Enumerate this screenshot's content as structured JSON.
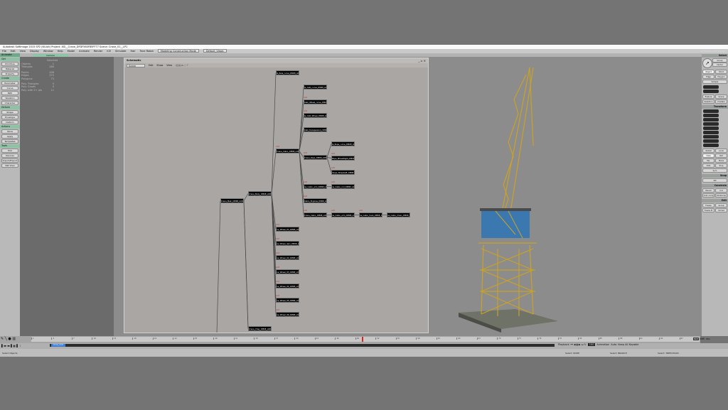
{
  "window": {
    "title": "Autodesk Softimage 2015 SP2 (64-bit)    Project: XSI__Crane_DFDF560F85FF77    Scene: Crane_01__LP1"
  },
  "menu": {
    "items": [
      "File",
      "Edit",
      "View",
      "Display",
      "Window",
      "Help",
      "Model",
      "Animate",
      "Render",
      "ICE",
      "Simulate",
      "Hair",
      "Face Robot"
    ],
    "mode": "Modeling Construction Mode",
    "layout": "Default_Views"
  },
  "toolbar": {
    "module": "Animate",
    "camera": "Camera",
    "brand": "AUTODESK SOFTIMAGE"
  },
  "left_panel": {
    "groups": [
      {
        "header": "Get",
        "items": [
          "Primitive",
          "Material",
          "Property"
        ]
      },
      {
        "header": "Create",
        "items": [
          "Parameter",
          "Curve",
          "Path",
          "Skeleton",
          "Character"
        ]
      },
      {
        "header": "Deform",
        "items": [
          "Shape",
          "Envelope",
          "Deform"
        ]
      },
      {
        "header": "Actions",
        "items": [
          "Store",
          "Apply",
          "Templates"
        ]
      },
      {
        "header": "Tools",
        "items": [
          "Plot",
          "Devices",
          "Import/Export",
          "Net View"
        ]
      }
    ]
  },
  "info": {
    "heading": "Selected",
    "rows": [
      [
        "Objects",
        "1"
      ],
      [
        "Triangles",
        "280"
      ],
      [
        "Points",
        "208"
      ],
      [
        "Edges",
        "272"
      ],
      [
        "Polygons",
        "73"
      ],
      [
        "Poly. Triangles",
        "0"
      ],
      [
        "Poly. Quads",
        "0"
      ],
      [
        "Poly. with 5+ pts",
        "11"
      ]
    ]
  },
  "schematic": {
    "title": "Schematic",
    "scope": "Scene",
    "menus": [
      "Edit",
      "Show",
      "View"
    ],
    "tag": "Add",
    "nodes": [
      "la_Rule_curve_DM08_LO",
      "la_Cabl_curve_DM08_LO",
      "Cabl_Wheel_curve_DM08",
      "la_Cabl_Wheel_DM08_LO",
      "Cabl_transparency_DM08",
      "Crane_Cabin_DM08_LOD0",
      "Crane_Rope_DM08_LOD0",
      "la_Rope_curve_DM08_LO",
      "Rope_WheelRight_DM08",
      "Rope_WheelLeft_DM08",
      "ne_Cabin_arm_DM08_LO",
      "ne_Cabin_rod_DM08_LO",
      "Cabin_Engines_DM08_LO",
      "Crane_Cabin_DM08_LOD0",
      "ne_Cabin_arm_DM08_LO",
      "ne_Cabin_hook_DM08_LO",
      "ne_Cabin_Chain_DM08_LO",
      "Crane_Body_DM08_LOD0",
      "Crane_Main_DM08_LOD0",
      "ne_Wheel_01_DM08_LO",
      "ne_Wheel_dam_DM08_LO",
      "ne_Wheel_02_DM08_LO",
      "ne_Wheel_03_DM08_LO",
      "ne_Wheel_04_DM08_LO",
      "ne_Wheel_05_DM08_LO",
      "ne_Wheel_06_DM08_LO",
      "Crane_Chay_DM08_LOD0"
    ]
  },
  "right_panel": {
    "select": "Select",
    "group": "Group",
    "center": "Center",
    "object": "Object",
    "point": "Point",
    "edge": "Edge",
    "polygon": "Polygon",
    "sample": "Sample",
    "explore": "Explore",
    "scene": "Scene",
    "selection": "Selection",
    "clusters": "Clusters",
    "transform": "Transform",
    "global": "Global",
    "local": "Local",
    "view": "View",
    "ref": "Ref",
    "par": "Par",
    "plane": "Plane",
    "cog": "COG",
    "prop": "Prop",
    "sym": "Sym",
    "snap": "Snap",
    "on": "ON",
    "constrain": "Constrain",
    "parent": "Parent",
    "cut": "Cut",
    "cnst_comp": "Cnst comp",
    "chld_comp": "ChldComp",
    "edit": "Edit",
    "freeze": "Freeze",
    "group2": "Group",
    "freeze_m": "Freeze M",
    "immed": "Immed"
  },
  "timeline": {
    "start": 1,
    "end": 100,
    "current": 50,
    "clip": "Crane_Anim",
    "playback": "Playback",
    "animation": "Animation",
    "auto": "Auto",
    "keyable": "Keep All Keyable",
    "frame": "100",
    "views": [
      "MCP",
      "KP/L",
      "PPG"
    ]
  },
  "status": {
    "left": "Select Objects",
    "node": "Select: NODE",
    "branch": "Select: BRANCH",
    "tree": "Select: TREE/CHAIN"
  },
  "colors": {
    "accent": "#8fc2a4",
    "node": "#000000",
    "crane": "#c9a227",
    "cabin": "#3c78b0"
  }
}
